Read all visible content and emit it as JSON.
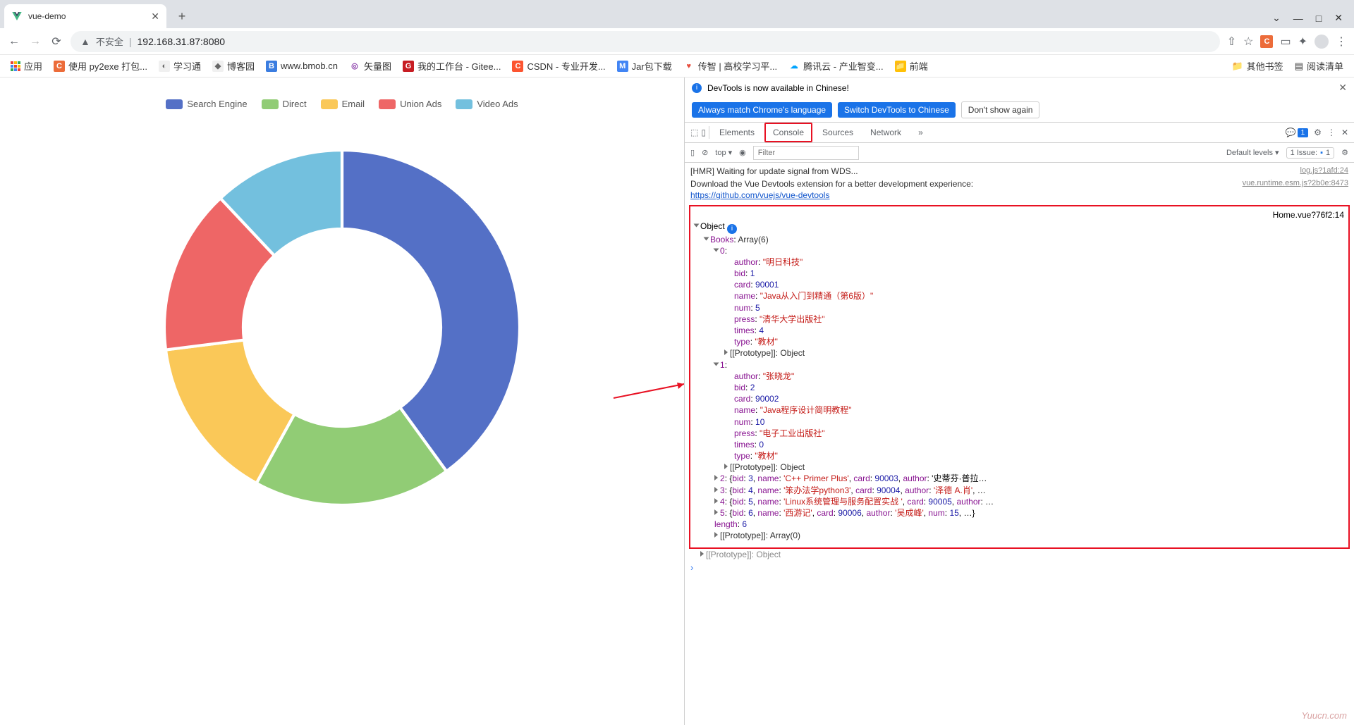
{
  "browser": {
    "tab_title": "vue-demo",
    "address_label": "不安全",
    "address_url": "192.168.31.87:8080",
    "window": {
      "dropdown": "⌄",
      "min": "—",
      "max": "□",
      "close": "✕"
    }
  },
  "bookmarks": {
    "apps": "应用",
    "items": [
      {
        "label": "使用 py2exe 打包...",
        "bg": "#ec6c3a",
        "fg": "#fff",
        "letter": "C"
      },
      {
        "label": "学习通",
        "bg": "#f0f0f0",
        "fg": "#666",
        "letter": "◐"
      },
      {
        "label": "博客园",
        "bg": "#f0f0f0",
        "fg": "#666",
        "letter": "◆"
      },
      {
        "label": "www.bmob.cn",
        "bg": "#3b7de0",
        "fg": "#fff",
        "letter": "B"
      },
      {
        "label": "矢量图",
        "bg": "#fff",
        "fg": "#8e44ad",
        "letter": "◎"
      },
      {
        "label": "我的工作台 - Gitee...",
        "bg": "#c71d23",
        "fg": "#fff",
        "letter": "G"
      },
      {
        "label": "CSDN - 专业开发...",
        "bg": "#fc5531",
        "fg": "#fff",
        "letter": "C"
      },
      {
        "label": "Jar包下载",
        "bg": "#4285f4",
        "fg": "#fff",
        "letter": "M"
      },
      {
        "label": "传智 | 高校学习平...",
        "bg": "#fff",
        "fg": "#e74c3c",
        "letter": "♥"
      },
      {
        "label": "腾讯云 - 产业智变...",
        "bg": "#fff",
        "fg": "#00a4ff",
        "letter": "☁"
      },
      {
        "label": "前端",
        "bg": "#ffc107",
        "fg": "#333",
        "letter": "📁"
      }
    ],
    "other": "其他书签",
    "reading": "阅读清单"
  },
  "chart_data": {
    "type": "pie",
    "title": "",
    "series": [
      {
        "name": "Search Engine",
        "value": 40,
        "color": "#5470c6"
      },
      {
        "name": "Direct",
        "value": 18,
        "color": "#91cc75"
      },
      {
        "name": "Email",
        "value": 15,
        "color": "#fac858"
      },
      {
        "name": "Union Ads",
        "value": 15,
        "color": "#ee6666"
      },
      {
        "name": "Video Ads",
        "value": 12,
        "color": "#73c0de"
      }
    ]
  },
  "devtools": {
    "notice": "DevTools is now available in Chinese!",
    "btn_match": "Always match Chrome's language",
    "btn_switch": "Switch DevTools to Chinese",
    "btn_dont": "Don't show again",
    "tabs": {
      "elements": "Elements",
      "console": "Console",
      "sources": "Sources",
      "network": "Network"
    },
    "msg_badge": "1",
    "filter_placeholder": "Filter",
    "default_levels": "Default levels ▾",
    "issue_label": "1 Issue:",
    "issue_count": "1",
    "top_label": "top ▾",
    "log1": "[HMR] Waiting for update signal from WDS...",
    "log1_src": "log.js?1afd:24",
    "log2a": "Download the Vue Devtools extension for a better development experience:",
    "log2_link": "https://github.com/vuejs/vue-devtools",
    "log2_src": "vue.runtime.esm.js?2b0e:8473",
    "obj_src": "Home.vue?76f2:14",
    "object_label": "Object",
    "books_label": "Books",
    "books_type": "Array(6)",
    "book0": {
      "author": "\"明日科技\"",
      "bid": "1",
      "card": "90001",
      "name": "\"Java从入门到精通（第6版）\"",
      "num": "5",
      "press": "\"清华大学出版社\"",
      "times": "4",
      "type": "\"教材\""
    },
    "book1": {
      "author": "\"张晓龙\"",
      "bid": "2",
      "card": "90002",
      "name": "\"Java程序设计简明教程\"",
      "num": "10",
      "press": "\"电子工业出版社\"",
      "times": "0",
      "type": "\"教材\""
    },
    "proto_obj": "[[Prototype]]: Object",
    "book2": "2: {bid: 3, name: 'C++ Primer Plus', card: 90003, author: '史蒂芬·普拉…",
    "book3": "3: {bid: 4, name: '笨办法学python3', card: 90004, author: '泽德 A.肖', …",
    "book4": "4: {bid: 5, name: 'Linux系统管理与服务配置实战 ', card: 90005, author: …",
    "book5": "5: {bid: 6, name: '西游记', card: 90006, author: '吴成峰', num: 15, …}",
    "length_label": "length",
    "length_val": "6",
    "proto_arr": "[[Prototype]]: Array(0)",
    "proto_outer": "[[Prototype]]: Object",
    "watermark": "Yuucn.com"
  }
}
